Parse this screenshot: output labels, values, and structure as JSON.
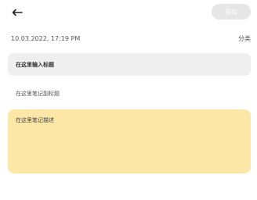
{
  "header": {
    "back_icon": "arrow-left-icon",
    "save_label": "保存"
  },
  "note": {
    "datetime": "10.03.2022, 17:19 PM",
    "category_label": "分类",
    "title_placeholder": "在这里输入标题",
    "subtitle_placeholder": "在这里笔记副标题",
    "description_placeholder": "在这里笔记描述"
  },
  "colors": {
    "save_button_bg": "#e6e6e6",
    "title_field_bg": "#efefef",
    "description_bg": "#fde7a6",
    "icon_color": "#222222"
  }
}
